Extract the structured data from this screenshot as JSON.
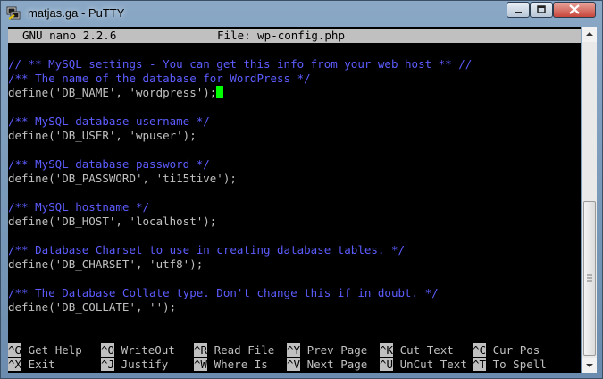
{
  "window": {
    "title": "matjas.ga - PuTTY"
  },
  "nano": {
    "version": "GNU nano 2.2.6",
    "file_label": "File: wp-config.php"
  },
  "editor_lines": [
    {
      "text": "// ** MySQL settings - You can get this info from your web host ** //",
      "type": "comment"
    },
    {
      "text": "/** The name of the database for WordPress */",
      "type": "comment"
    },
    {
      "text": "define('DB_NAME', 'wordpress');",
      "type": "code"
    },
    {
      "text": "",
      "type": "code"
    },
    {
      "text": "/** MySQL database username */",
      "type": "comment"
    },
    {
      "text": "define('DB_USER', 'wpuser');",
      "type": "code"
    },
    {
      "text": "",
      "type": "code"
    },
    {
      "text": "/** MySQL database password */",
      "type": "comment"
    },
    {
      "text": "define('DB_PASSWORD', 'ti15tive');",
      "type": "code"
    },
    {
      "text": "",
      "type": "code"
    },
    {
      "text": "/** MySQL hostname */",
      "type": "comment"
    },
    {
      "text": "define('DB_HOST', 'localhost');",
      "type": "code"
    },
    {
      "text": "",
      "type": "code"
    },
    {
      "text": "/** Database Charset to use in creating database tables. */",
      "type": "comment"
    },
    {
      "text": "define('DB_CHARSET', 'utf8');",
      "type": "code"
    },
    {
      "text": "",
      "type": "code"
    },
    {
      "text": "/** The Database Collate type. Don't change this if in doubt. */",
      "type": "comment"
    },
    {
      "text": "define('DB_COLLATE', '');",
      "type": "code"
    }
  ],
  "shortcuts": [
    {
      "key": "^G",
      "label": "Get Help"
    },
    {
      "key": "^O",
      "label": "WriteOut"
    },
    {
      "key": "^R",
      "label": "Read File"
    },
    {
      "key": "^Y",
      "label": "Prev Page"
    },
    {
      "key": "^K",
      "label": "Cut Text"
    },
    {
      "key": "^C",
      "label": "Cur Pos"
    },
    {
      "key": "^X",
      "label": "Exit"
    },
    {
      "key": "^J",
      "label": "Justify"
    },
    {
      "key": "^W",
      "label": "Where Is"
    },
    {
      "key": "^V",
      "label": "Next Page"
    },
    {
      "key": "^U",
      "label": "UnCut Text"
    },
    {
      "key": "^T",
      "label": "To Spell"
    }
  ],
  "colors": {
    "terminal_bg": "#000000",
    "text": "#c0c0c0",
    "comment": "#5c5cff",
    "cursor": "#00ff00",
    "header_bg": "#c0c0c0"
  }
}
